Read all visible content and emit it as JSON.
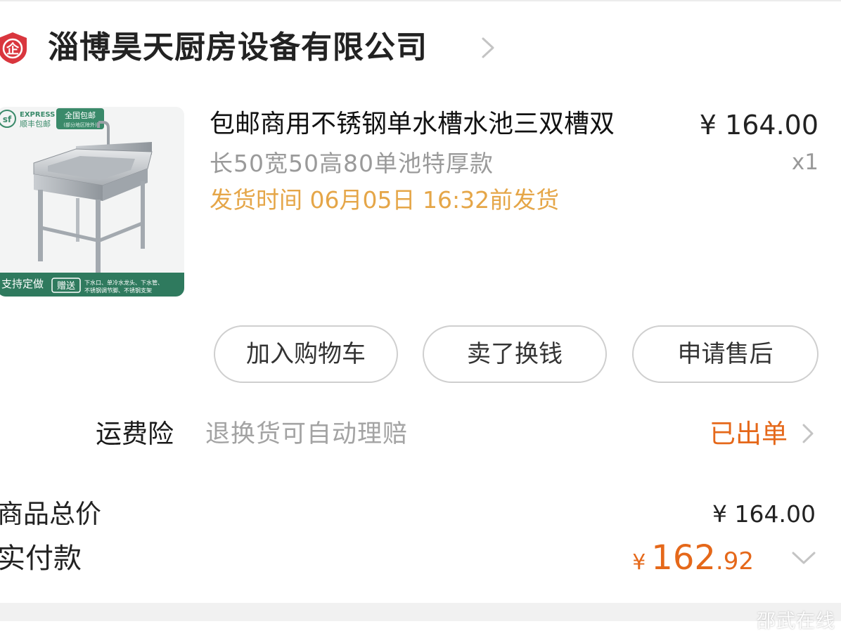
{
  "shop": {
    "badge_icon": "enterprise-badge-icon",
    "badge_glyph": "企",
    "name": "淄博昊天厨房设备有限公司",
    "chevron_icon": "chevron-right-icon"
  },
  "product": {
    "image": {
      "icon": "stainless-sink-product-image",
      "express_badge": "EXPRESS",
      "express_badge_cn": "顺丰包邮",
      "free_shipping": "全国包邮",
      "free_shipping_note": "(部分地区除外)",
      "custom_tag": "支持定做",
      "gift_tag": "赠送",
      "gift_desc_line1": "下水口、单冷水龙头、下水管、",
      "gift_desc_line2": "不锈钢调节脚、不锈钢支架"
    },
    "title": "包邮商用不锈钢单水槽水池三双槽双",
    "spec": "长50宽50高80单池特厚款",
    "shipping_time": "发货时间 06月05日 16:32前发货",
    "price": "¥ 164.00",
    "quantity": "x1"
  },
  "actions": {
    "add_to_cart": "加入购物车",
    "sell_for_cash": "卖了换钱",
    "after_sales": "申请售后"
  },
  "insurance": {
    "label": "运费险",
    "description": "退换货可自动理赔",
    "status": "已出单"
  },
  "summary": {
    "total_label": "商品总价",
    "total_value": "¥ 164.00",
    "paid_label": "实付款",
    "paid_currency": "¥",
    "paid_integer": "162",
    "paid_decimal": ".92"
  },
  "watermark": "邵武在线",
  "colors": {
    "accent_orange": "#e5681a",
    "shipping_yellow": "#e5a648",
    "badge_red": "#d9363e"
  }
}
